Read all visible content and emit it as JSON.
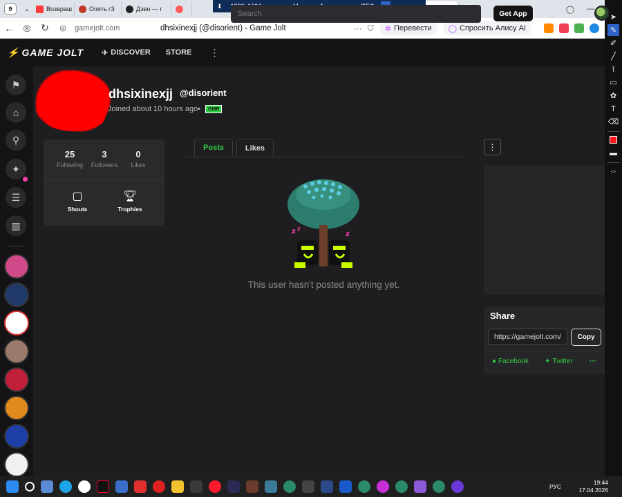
{
  "browser": {
    "tab_count": "9",
    "tabs": [
      {
        "label": "Возвраш",
        "color": "#ff3b3b"
      },
      {
        "label": "Опять гЗ",
        "color": "#c0392b"
      },
      {
        "label": "Дзен — г",
        "color": "#222222"
      },
      {
        "label": "",
        "color": "#ff5b5b"
      }
    ],
    "recording": {
      "resolution": "1280x1024",
      "monitor": "Монитор 1",
      "rec": "REC"
    },
    "active_tab": "dhsixi",
    "address": {
      "domain": "gamejolt.com",
      "title": "dhsixinexjj (@disorient) - Game Jolt",
      "translate": "Перевести",
      "alice": "Спросить Алису AI"
    }
  },
  "gj": {
    "logo": "GAME JOLT",
    "nav": {
      "discover": "DISCOVER",
      "store": "STORE"
    },
    "search_placeholder": "Search",
    "get_app": "Get App"
  },
  "profile": {
    "username": "dhsixinexjj",
    "handle": "@disorient",
    "joined": "Joined about 10 hours ago",
    "badge": "GMR",
    "stats": [
      {
        "value": "25",
        "label": "Following"
      },
      {
        "value": "3",
        "label": "Followers"
      },
      {
        "value": "0",
        "label": "Likes"
      }
    ],
    "shouts_label": "Shouts",
    "trophies_label": "Trophies",
    "tabs": {
      "posts": "Posts",
      "likes": "Likes"
    },
    "empty_message": "This user hasn't posted anything yet."
  },
  "share": {
    "title": "Share",
    "url": "https://gamejolt.com/",
    "copy": "Copy",
    "facebook": "Facebook",
    "twitter": "Twitter"
  },
  "taskbar": {
    "lang": "РУС",
    "time": "19:44",
    "date": "17.04.2026"
  },
  "colors": {
    "accent_green": "#2ecc40",
    "bg": "#1e1e21",
    "topbar": "#141416",
    "gj_pink": "#ff3fac"
  }
}
